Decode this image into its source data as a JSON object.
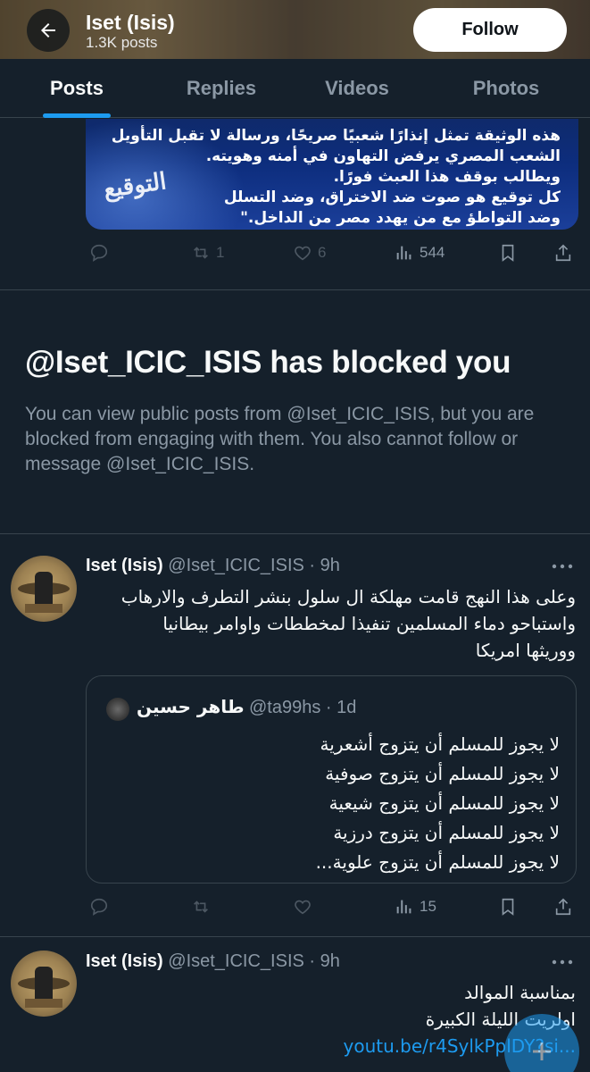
{
  "header": {
    "title": "Iset (Isis)",
    "post_count": "1.3K posts",
    "follow_label": "Follow"
  },
  "tabs": [
    {
      "label": "Posts",
      "active": true
    },
    {
      "label": "Replies",
      "active": false
    },
    {
      "label": "Videos",
      "active": false
    },
    {
      "label": "Photos",
      "active": false
    }
  ],
  "top_post": {
    "image_lines": [
      "هذه الوثيقة تمثل إنذارًا شعبيًا صريحًا، ورسالة لا تقبل التأويل",
      "الشعب المصري يرفض التهاون في أمنه وهويته.",
      "ويطالب بوقف هذا العبث فورًا.",
      "كل توقيع هو صوت ضد الاختراق، وضد التسلل",
      "وضد التواطؤ مع من يهدد مصر من الداخل.\""
    ],
    "image_signature": "التوقيع",
    "actions": {
      "reply": "",
      "repost": "1",
      "like": "6",
      "views": "544"
    }
  },
  "blocked": {
    "title": "@Iset_ICIC_ISIS has blocked you",
    "description": "You can view public posts from @Iset_ICIC_ISIS, but you are blocked from engaging with them. You also cannot follow or message @Iset_ICIC_ISIS."
  },
  "post1": {
    "name": "Iset (Isis)",
    "handle": "@Iset_ICIC_ISIS · 9h",
    "text_lines": [
      "وعلى هذا النهج قامت مهلكة ال سلول بنشر التطرف والارهاب",
      "واستباحو دماء المسلمين تنفيذا  لمخططات واوامر   بيطانيا",
      "ووريثها امريكا"
    ],
    "quote": {
      "name": "طاهر حسين",
      "handle": "@ta99hs · 1d",
      "lines": [
        "لا يجوز للمسلم أن يتزوج أشعرية",
        "لا يجوز للمسلم أن يتزوج صوفية",
        "لا يجوز للمسلم أن يتزوج شيعية",
        "لا يجوز للمسلم أن يتزوج درزية",
        "لا يجوز للمسلم أن يتزوج علوية..."
      ]
    },
    "actions": {
      "views": "15"
    }
  },
  "post2": {
    "name": "Iset (Isis)",
    "handle": "@Iset_ICIC_ISIS · 9h",
    "text_lines": [
      "بمناسبة الموالد",
      "اولريت الليلة الكبيرة"
    ],
    "link": "youtu.be/r4SylkPplDY?si..."
  },
  "colors": {
    "background": "#15202b",
    "accent": "#1d9bf0",
    "secondary_text": "#8b98a5",
    "border": "#38444d"
  }
}
